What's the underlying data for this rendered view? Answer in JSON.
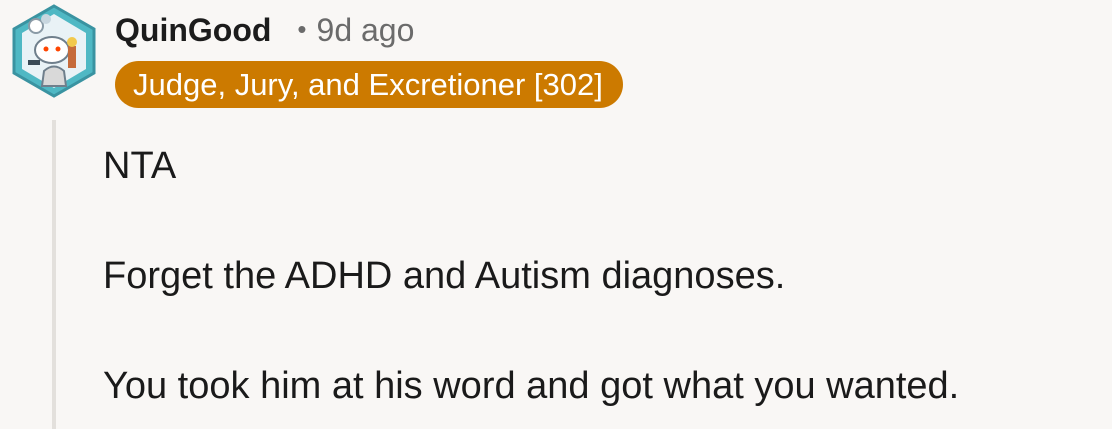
{
  "comment": {
    "username": "QuinGood",
    "separator": "•",
    "timestamp": "9d ago",
    "flair": {
      "text": "Judge, Jury, and Excretioner [302]",
      "color": "#cc7a00"
    },
    "avatar_icon": "snoo-avatar-icon",
    "body": [
      "NTA",
      "Forget the ADHD and Autism diagnoses.",
      "You took him at his word and got what you wanted."
    ]
  }
}
